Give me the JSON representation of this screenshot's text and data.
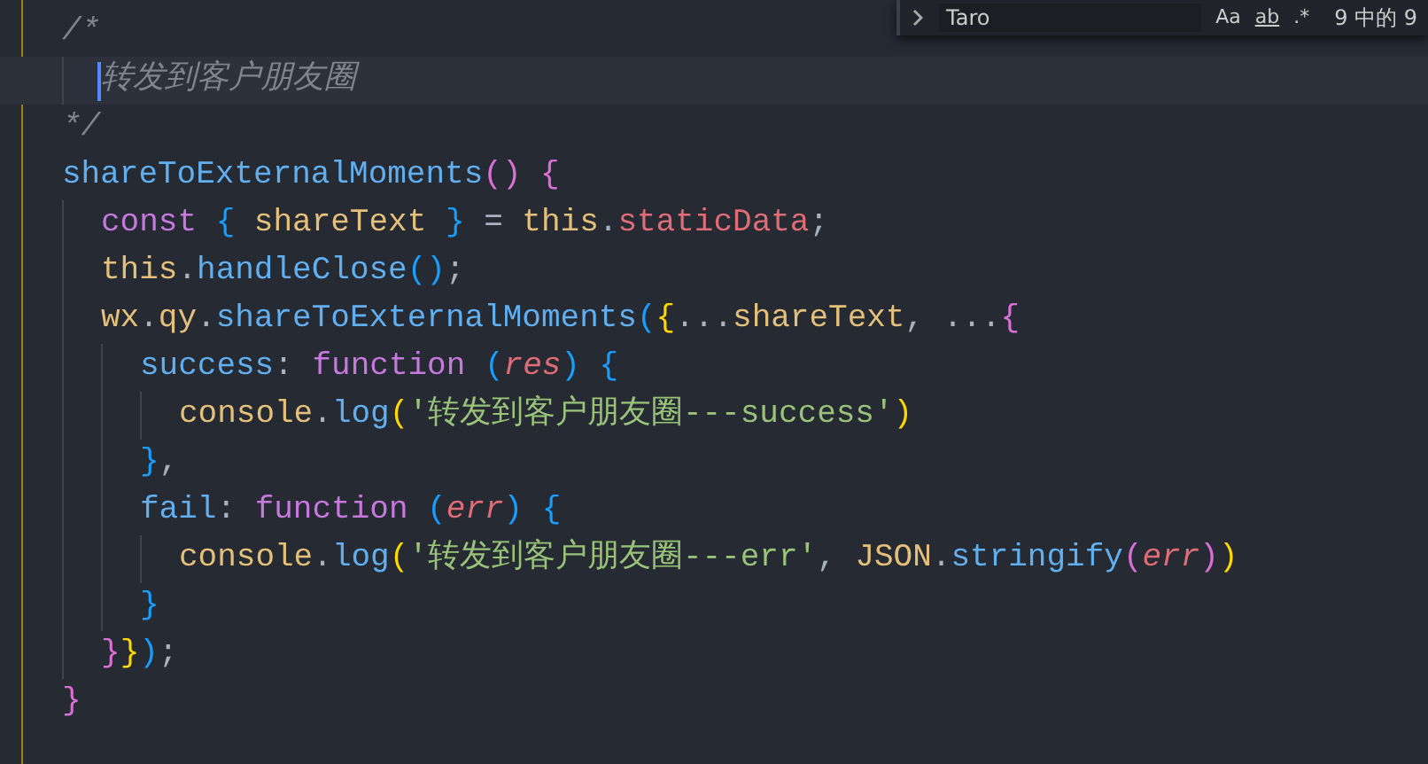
{
  "find_widget": {
    "query": "Taro",
    "options": [
      {
        "label": "Aa",
        "underlined": false
      },
      {
        "label": "ab",
        "underlined": true
      },
      {
        "label": ".*",
        "underlined": false
      }
    ],
    "match_count": "9 中的 9"
  },
  "code_lines": [
    {
      "current": false,
      "tokens": [
        {
          "text": "/*",
          "kind": "comment"
        }
      ],
      "children": [
        {
          "current": true,
          "tokens": [
            {
              "text": "转发到客户朋友圈",
              "kind": "comment"
            }
          ]
        }
      ]
    },
    {
      "current": false,
      "tokens": [
        {
          "text": "*/",
          "kind": "comment"
        }
      ]
    },
    {
      "current": false,
      "tokens": [
        {
          "text": "shareToExternalMoments",
          "kind": "function"
        },
        {
          "text": "()",
          "kind": "bracket2"
        },
        {
          "text": " {",
          "kind": "bracket2"
        }
      ],
      "children": [
        {
          "current": false,
          "tokens": [
            {
              "text": "const",
              "kind": "keyword"
            },
            {
              "text": " {",
              "kind": "bracket3"
            },
            {
              "text": " shareText ",
              "kind": "variable"
            },
            {
              "text": "}",
              "kind": "bracket3"
            },
            {
              "text": " = ",
              "kind": "punct"
            },
            {
              "text": "this",
              "kind": "variable"
            },
            {
              "text": ".",
              "kind": "punct"
            },
            {
              "text": "staticData",
              "kind": "property"
            },
            {
              "text": ";",
              "kind": "punct"
            }
          ]
        },
        {
          "current": false,
          "tokens": [
            {
              "text": "this",
              "kind": "variable"
            },
            {
              "text": ".",
              "kind": "punct"
            },
            {
              "text": "handleClose",
              "kind": "function"
            },
            {
              "text": "()",
              "kind": "bracket3"
            },
            {
              "text": ";",
              "kind": "punct"
            }
          ]
        },
        {
          "current": false,
          "tokens": [
            {
              "text": "wx",
              "kind": "variable"
            },
            {
              "text": ".",
              "kind": "punct"
            },
            {
              "text": "qy",
              "kind": "variable"
            },
            {
              "text": ".",
              "kind": "punct"
            },
            {
              "text": "shareToExternalMoments",
              "kind": "function"
            },
            {
              "text": "(",
              "kind": "bracket3"
            },
            {
              "text": "{",
              "kind": "bracket1"
            },
            {
              "text": "...",
              "kind": "punct"
            },
            {
              "text": "shareText",
              "kind": "variable"
            },
            {
              "text": ", ...",
              "kind": "punct"
            },
            {
              "text": "{",
              "kind": "bracket2"
            }
          ],
          "children": [
            {
              "current": false,
              "tokens": [
                {
                  "text": "success",
                  "kind": "function"
                },
                {
                  "text": ": ",
                  "kind": "punct"
                },
                {
                  "text": "function",
                  "kind": "keyword"
                },
                {
                  "text": " (",
                  "kind": "bracket3"
                },
                {
                  "text": "res",
                  "kind": "param"
                },
                {
                  "text": ")",
                  "kind": "bracket3"
                },
                {
                  "text": " {",
                  "kind": "bracket3"
                }
              ],
              "children": [
                {
                  "current": false,
                  "tokens": [
                    {
                      "text": "console",
                      "kind": "variable"
                    },
                    {
                      "text": ".",
                      "kind": "punct"
                    },
                    {
                      "text": "log",
                      "kind": "function"
                    },
                    {
                      "text": "(",
                      "kind": "bracket1"
                    },
                    {
                      "text": "'转发到客户朋友圈---success'",
                      "kind": "string"
                    },
                    {
                      "text": ")",
                      "kind": "bracket1"
                    }
                  ]
                }
              ]
            },
            {
              "current": false,
              "tokens": [
                {
                  "text": "}",
                  "kind": "bracket3"
                },
                {
                  "text": ",",
                  "kind": "punct"
                }
              ]
            },
            {
              "current": false,
              "tokens": [
                {
                  "text": "fail",
                  "kind": "function"
                },
                {
                  "text": ": ",
                  "kind": "punct"
                },
                {
                  "text": "function",
                  "kind": "keyword"
                },
                {
                  "text": " (",
                  "kind": "bracket3"
                },
                {
                  "text": "err",
                  "kind": "param"
                },
                {
                  "text": ")",
                  "kind": "bracket3"
                },
                {
                  "text": " {",
                  "kind": "bracket3"
                }
              ],
              "children": [
                {
                  "current": false,
                  "tokens": [
                    {
                      "text": "console",
                      "kind": "variable"
                    },
                    {
                      "text": ".",
                      "kind": "punct"
                    },
                    {
                      "text": "log",
                      "kind": "function"
                    },
                    {
                      "text": "(",
                      "kind": "bracket1"
                    },
                    {
                      "text": "'转发到客户朋友圈---err'",
                      "kind": "string"
                    },
                    {
                      "text": ", ",
                      "kind": "punct"
                    },
                    {
                      "text": "JSON",
                      "kind": "variable"
                    },
                    {
                      "text": ".",
                      "kind": "punct"
                    },
                    {
                      "text": "stringify",
                      "kind": "function"
                    },
                    {
                      "text": "(",
                      "kind": "bracket2"
                    },
                    {
                      "text": "err",
                      "kind": "param"
                    },
                    {
                      "text": ")",
                      "kind": "bracket2"
                    },
                    {
                      "text": ")",
                      "kind": "bracket1"
                    }
                  ]
                }
              ]
            },
            {
              "current": false,
              "tokens": [
                {
                  "text": "}",
                  "kind": "bracket3"
                }
              ]
            }
          ]
        },
        {
          "current": false,
          "tokens": [
            {
              "text": "}",
              "kind": "bracket2"
            },
            {
              "text": "}",
              "kind": "bracket1"
            },
            {
              "text": ")",
              "kind": "bracket3"
            },
            {
              "text": ";",
              "kind": "punct"
            }
          ]
        }
      ]
    },
    {
      "current": false,
      "tokens": [
        {
          "text": "}",
          "kind": "bracket2"
        }
      ]
    }
  ]
}
